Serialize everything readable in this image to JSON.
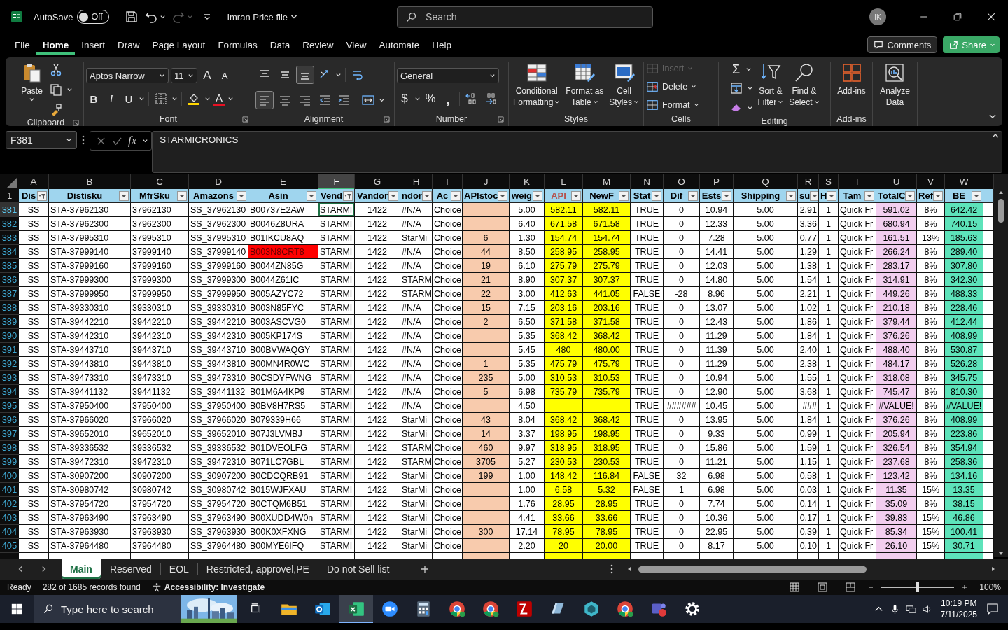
{
  "title_bar": {
    "autosave_label": "AutoSave",
    "autosave": {
      "on": false,
      "label": "Off"
    },
    "redo": {
      "disabled": true
    },
    "file_name": "Imran Price file",
    "search_placeholder": "Search",
    "avatar": "IK"
  },
  "menu_tabs": [
    {
      "label": "File",
      "selected": false
    },
    {
      "label": "Home",
      "selected": true
    },
    {
      "label": "Insert",
      "selected": false
    },
    {
      "label": "Draw",
      "selected": false
    },
    {
      "label": "Page Layout",
      "selected": false
    },
    {
      "label": "Formulas",
      "selected": false
    },
    {
      "label": "Data",
      "selected": false
    },
    {
      "label": "Review",
      "selected": false
    },
    {
      "label": "View",
      "selected": false
    },
    {
      "label": "Automate",
      "selected": false
    },
    {
      "label": "Help",
      "selected": false
    }
  ],
  "comments_button": "Comments",
  "share_button": "Share",
  "ribbon": {
    "groups": [
      {
        "kind": "clipboard",
        "label": "Clipboard",
        "paste": "Paste"
      },
      {
        "kind": "font",
        "label": "Font",
        "font_name": "Aptos Narrow",
        "font_size": "11",
        "grow": "A",
        "shrink": "A",
        "styles": [
          "B",
          "I",
          "U"
        ],
        "font_color": "A"
      },
      {
        "kind": "alignment",
        "label": "Alignment",
        "vertical": [
          {
            "on": false
          },
          {
            "on": false
          },
          {
            "on": true
          }
        ],
        "horizontal": [
          {
            "on": true
          },
          {
            "on": false
          },
          {
            "on": false
          }
        ]
      },
      {
        "kind": "number",
        "label": "Number",
        "format": "General",
        "currency": "$",
        "percent": "%",
        "comma": ","
      },
      {
        "kind": "styles",
        "label": "Styles",
        "buttons": [
          {
            "line1": "Conditional",
            "line2": "Formatting"
          },
          {
            "line1": "Format as",
            "line2": "Table"
          },
          {
            "line1": "Cell",
            "line2": "Styles"
          }
        ]
      },
      {
        "kind": "cells",
        "label": "Cells",
        "buttons": [
          {
            "label": "Insert",
            "disabled": true
          },
          {
            "label": "Delete",
            "disabled": false
          },
          {
            "label": "Format",
            "disabled": false
          }
        ]
      },
      {
        "kind": "editing",
        "label": "Editing",
        "sum": "Σ",
        "buttons": [
          {
            "line1": "Sort &",
            "line2": "Filter"
          },
          {
            "line1": "Find &",
            "line2": "Select"
          }
        ]
      },
      {
        "kind": "addins",
        "label": "Add-ins",
        "button": "Add-ins"
      },
      {
        "kind": "analyze",
        "line1": "Analyze",
        "line2": "Data"
      }
    ]
  },
  "formula_bar": {
    "name_box": "F381",
    "fx": "fx",
    "content": "STARMICRONICS"
  },
  "columns": [
    {
      "letter": "A",
      "header": "Dis",
      "filtered": true,
      "selected": false,
      "header_warning": false
    },
    {
      "letter": "B",
      "header": "Distisku",
      "filtered": false,
      "selected": false,
      "header_warning": false
    },
    {
      "letter": "C",
      "header": "MfrSku",
      "filtered": false,
      "selected": false,
      "header_warning": false
    },
    {
      "letter": "D",
      "header": "Amazons",
      "filtered": false,
      "selected": false,
      "header_warning": false
    },
    {
      "letter": "E",
      "header": "Asin",
      "filtered": false,
      "selected": false,
      "header_warning": false
    },
    {
      "letter": "F",
      "header": "Vend",
      "filtered": true,
      "selected": true,
      "header_warning": false
    },
    {
      "letter": "G",
      "header": "Vandor",
      "filtered": false,
      "selected": false,
      "header_warning": false
    },
    {
      "letter": "H",
      "header": "ndor",
      "filtered": false,
      "selected": false,
      "header_warning": false
    },
    {
      "letter": "I",
      "header": "Ac",
      "filtered": false,
      "selected": false,
      "header_warning": false
    },
    {
      "letter": "J",
      "header": "APIstoc",
      "filtered": false,
      "selected": false,
      "header_warning": false,
      "color": "#f8cbad"
    },
    {
      "letter": "K",
      "header": "weig",
      "filtered": false,
      "selected": false,
      "header_warning": false
    },
    {
      "letter": "L",
      "header": "API",
      "filtered": false,
      "selected": false,
      "header_warning": true,
      "color": "#ffff00"
    },
    {
      "letter": "M",
      "header": "NewF",
      "filtered": false,
      "selected": false,
      "header_warning": false,
      "color": "#ffff00"
    },
    {
      "letter": "N",
      "header": "Stat",
      "filtered": false,
      "selected": false,
      "header_warning": false
    },
    {
      "letter": "O",
      "header": "Dif",
      "filtered": false,
      "selected": false,
      "header_warning": false
    },
    {
      "letter": "P",
      "header": "Ests",
      "filtered": false,
      "selected": false,
      "header_warning": false
    },
    {
      "letter": "Q",
      "header": "Shipping",
      "filtered": false,
      "selected": false,
      "header_warning": false
    },
    {
      "letter": "R",
      "header": "su",
      "filtered": false,
      "selected": false,
      "header_warning": false
    },
    {
      "letter": "S",
      "header": "H",
      "filtered": false,
      "selected": false,
      "header_warning": false
    },
    {
      "letter": "T",
      "header": "Tam",
      "filtered": false,
      "selected": false,
      "header_warning": false
    },
    {
      "letter": "U",
      "header": "TotalC",
      "filtered": false,
      "selected": false,
      "header_warning": false,
      "color": "#f2ceef"
    },
    {
      "letter": "V",
      "header": "Ref",
      "filtered": false,
      "selected": false,
      "header_warning": false
    },
    {
      "letter": "W",
      "header": "BE",
      "filtered": false,
      "selected": false,
      "header_warning": false,
      "color": "#5de3ba"
    }
  ],
  "header_row": "1",
  "rows": [
    {
      "n": "381",
      "selected": true,
      "flagged": false,
      "cells": [
        "SS",
        "STA-37962130",
        "37962130",
        "SS_37962130",
        "B00737E2AW",
        "STARMI",
        "1422",
        "#N/A",
        "Choice",
        null,
        "5.00",
        "582.11",
        "582.11",
        "TRUE",
        "0",
        "10.94",
        "5.00",
        "2.91",
        "1",
        "Quick Fr",
        "591.02",
        "8%",
        "642.42"
      ]
    },
    {
      "n": "382",
      "selected": false,
      "flagged": false,
      "cells": [
        "SS",
        "STA-37962300",
        "37962300",
        "SS_37962300",
        "B0046Z8URA",
        "STARMI",
        "1422",
        "#N/A",
        "Choice",
        null,
        "6.40",
        "671.58",
        "671.58",
        "TRUE",
        "0",
        "12.33",
        "5.00",
        "3.36",
        "1",
        "Quick Fr",
        "680.94",
        "8%",
        "740.15"
      ]
    },
    {
      "n": "383",
      "selected": false,
      "flagged": false,
      "cells": [
        "SS",
        "STA-37995310",
        "37995310",
        "SS_37995310",
        "B01IKCU8AQ",
        "STARMI",
        "1422",
        "StarMi",
        "Choice",
        "6",
        "1.30",
        "154.74",
        "154.74",
        "TRUE",
        "0",
        "7.28",
        "5.00",
        "0.77",
        "1",
        "Quick Fr",
        "161.51",
        "13%",
        "185.63"
      ]
    },
    {
      "n": "384",
      "selected": false,
      "flagged": true,
      "cells": [
        "SS",
        "STA-37999140",
        "37999140",
        "SS_37999140",
        "B003N8CRT8",
        "STARMI",
        "1422",
        "#N/A",
        "Choice",
        "44",
        "8.50",
        "258.95",
        "258.95",
        "TRUE",
        "0",
        "14.41",
        "5.00",
        "1.29",
        "1",
        "Quick Fr",
        "266.24",
        "8%",
        "289.40"
      ]
    },
    {
      "n": "385",
      "selected": false,
      "flagged": false,
      "cells": [
        "SS",
        "STA-37999160",
        "37999160",
        "SS_37999160",
        "B0044ZN85G",
        "STARMI",
        "1422",
        "#N/A",
        "Choice",
        "19",
        "6.10",
        "275.79",
        "275.79",
        "TRUE",
        "0",
        "12.03",
        "5.00",
        "1.38",
        "1",
        "Quick Fr",
        "283.17",
        "8%",
        "307.80"
      ]
    },
    {
      "n": "386",
      "selected": false,
      "flagged": false,
      "cells": [
        "SS",
        "STA-37999300",
        "37999300",
        "SS_37999300",
        "B0044Z61IC",
        "STARMI",
        "1422",
        "STARM",
        "Choice",
        "21",
        "8.90",
        "307.37",
        "307.37",
        "TRUE",
        "0",
        "14.80",
        "5.00",
        "1.54",
        "1",
        "Quick Fr",
        "314.91",
        "8%",
        "342.30"
      ]
    },
    {
      "n": "387",
      "selected": false,
      "flagged": false,
      "cells": [
        "SS",
        "STA-37999950",
        "37999950",
        "SS_37999950",
        "B005AZYC72",
        "STARMI",
        "1422",
        "STARM",
        "Choice",
        "22",
        "3.00",
        "412.63",
        "441.05",
        "FALSE",
        "-28",
        "8.96",
        "5.00",
        "2.21",
        "1",
        "Quick Fr",
        "449.26",
        "8%",
        "488.33"
      ]
    },
    {
      "n": "388",
      "selected": false,
      "flagged": false,
      "cells": [
        "SS",
        "STA-39330310",
        "39330310",
        "SS_39330310",
        "B003N85FYC",
        "STARMI",
        "1422",
        "#N/A",
        "Choice",
        "15",
        "7.15",
        "203.16",
        "203.16",
        "TRUE",
        "0",
        "13.07",
        "5.00",
        "1.02",
        "1",
        "Quick Fr",
        "210.18",
        "8%",
        "228.46"
      ]
    },
    {
      "n": "389",
      "selected": false,
      "flagged": false,
      "cells": [
        "SS",
        "STA-39442210",
        "39442210",
        "SS_39442210",
        "B003ASCVG0",
        "STARMI",
        "1422",
        "#N/A",
        "Choice",
        "2",
        "6.50",
        "371.58",
        "371.58",
        "TRUE",
        "0",
        "12.43",
        "5.00",
        "1.86",
        "1",
        "Quick Fr",
        "379.44",
        "8%",
        "412.44"
      ]
    },
    {
      "n": "390",
      "selected": false,
      "flagged": false,
      "cells": [
        "SS",
        "STA-39442310",
        "39442310",
        "SS_39442310",
        "B005KP174S",
        "STARMI",
        "1422",
        "#N/A",
        "Choice",
        null,
        "5.35",
        "368.42",
        "368.42",
        "TRUE",
        "0",
        "11.29",
        "5.00",
        "1.84",
        "1",
        "Quick Fr",
        "376.26",
        "8%",
        "408.99"
      ]
    },
    {
      "n": "391",
      "selected": false,
      "flagged": false,
      "cells": [
        "SS",
        "STA-39443710",
        "39443710",
        "SS_39443710",
        "B00BVWAQGY",
        "STARMI",
        "1422",
        "#N/A",
        "Choice",
        null,
        "5.45",
        "480",
        "480.00",
        "TRUE",
        "0",
        "11.39",
        "5.00",
        "2.40",
        "1",
        "Quick Fr",
        "488.40",
        "8%",
        "530.87"
      ]
    },
    {
      "n": "392",
      "selected": false,
      "flagged": false,
      "cells": [
        "SS",
        "STA-39443810",
        "39443810",
        "SS_39443810",
        "B00MN4R0WC",
        "STARMI",
        "1422",
        "#N/A",
        "Choice",
        "1",
        "5.35",
        "475.79",
        "475.79",
        "TRUE",
        "0",
        "11.29",
        "5.00",
        "2.38",
        "1",
        "Quick Fr",
        "484.17",
        "8%",
        "526.28"
      ]
    },
    {
      "n": "393",
      "selected": false,
      "flagged": false,
      "cells": [
        "SS",
        "STA-39473310",
        "39473310",
        "SS_39473310",
        "B0CSDYFWNG",
        "STARMI",
        "1422",
        "#N/A",
        "Choice",
        "235",
        "5.00",
        "310.53",
        "310.53",
        "TRUE",
        "0",
        "10.94",
        "5.00",
        "1.55",
        "1",
        "Quick Fr",
        "318.08",
        "8%",
        "345.75"
      ]
    },
    {
      "n": "394",
      "selected": false,
      "flagged": false,
      "cells": [
        "SS",
        "STA-39441132",
        "39441132",
        "SS_39441132",
        "B01M6A4KP9",
        "STARMI",
        "1422",
        "#N/A",
        "Choice",
        "5",
        "6.98",
        "735.79",
        "735.79",
        "TRUE",
        "0",
        "12.90",
        "5.00",
        "3.68",
        "1",
        "Quick Fr",
        "745.47",
        "8%",
        "810.30"
      ]
    },
    {
      "n": "395",
      "selected": false,
      "flagged": false,
      "cells": [
        "SS",
        "STA-37950400",
        "37950400",
        "SS_37950400",
        "B0BV8H7RS5",
        "STARMI",
        "1422",
        "#N/A",
        "Choice",
        null,
        "4.50",
        null,
        null,
        "TRUE",
        "######",
        "10.45",
        "5.00",
        "###",
        "1",
        "Quick Fr",
        "#VALUE!",
        "8%",
        "#VALUE!"
      ]
    },
    {
      "n": "396",
      "selected": false,
      "flagged": false,
      "cells": [
        "SS",
        "STA-37966020",
        "37966020",
        "SS_37966020",
        "B079339H66",
        "STARMI",
        "1422",
        "StarMi",
        "Choice",
        "43",
        "8.04",
        "368.42",
        "368.42",
        "TRUE",
        "0",
        "13.95",
        "5.00",
        "1.84",
        "1",
        "Quick Fr",
        "376.26",
        "8%",
        "408.99"
      ]
    },
    {
      "n": "397",
      "selected": false,
      "flagged": false,
      "cells": [
        "SS",
        "STA-39652010",
        "39652010",
        "SS_39652010",
        "B07J3LVMBJ",
        "STARMI",
        "1422",
        "StarMi",
        "Choice",
        "14",
        "3.37",
        "198.95",
        "198.95",
        "TRUE",
        "0",
        "9.33",
        "5.00",
        "0.99",
        "1",
        "Quick Fr",
        "205.94",
        "8%",
        "223.86"
      ]
    },
    {
      "n": "398",
      "selected": false,
      "flagged": false,
      "cells": [
        "SS",
        "STA-39336532",
        "39336532",
        "SS_39336532",
        "B01DVEOLFG",
        "STARMI",
        "1422",
        "STARM",
        "Choice",
        "460",
        "9.97",
        "318.95",
        "318.95",
        "TRUE",
        "0",
        "15.86",
        "5.00",
        "1.59",
        "1",
        "Quick Fr",
        "326.54",
        "8%",
        "354.94"
      ]
    },
    {
      "n": "399",
      "selected": false,
      "flagged": false,
      "cells": [
        "SS",
        "STA-39472310",
        "39472310",
        "SS_39472310",
        "B071LC7GBL",
        "STARMI",
        "1422",
        "STARM",
        "Choice",
        "3705",
        "5.27",
        "230.53",
        "230.53",
        "TRUE",
        "0",
        "11.21",
        "5.00",
        "1.15",
        "1",
        "Quick Fr",
        "237.68",
        "8%",
        "258.36"
      ]
    },
    {
      "n": "400",
      "selected": false,
      "flagged": false,
      "cells": [
        "SS",
        "STA-30907200",
        "30907200",
        "SS_30907200",
        "B0CDCQRB91",
        "STARMI",
        "1422",
        "StarMi",
        "Choice",
        "199",
        "1.00",
        "148.42",
        "116.84",
        "FALSE",
        "32",
        "6.98",
        "5.00",
        "0.58",
        "1",
        "Quick Fr",
        "123.42",
        "8%",
        "134.16"
      ]
    },
    {
      "n": "401",
      "selected": false,
      "flagged": false,
      "cells": [
        "SS",
        "STA-30980742",
        "30980742",
        "SS_30980742",
        "B015WJFXAU",
        "STARMI",
        "1422",
        "StarMi",
        "Choice",
        null,
        "1.00",
        "6.58",
        "5.32",
        "FALSE",
        "1",
        "6.98",
        "5.00",
        "0.03",
        "1",
        "Quick Fr",
        "11.35",
        "15%",
        "13.35"
      ]
    },
    {
      "n": "402",
      "selected": false,
      "flagged": false,
      "cells": [
        "SS",
        "STA-37954720",
        "37954720",
        "SS_37954720",
        "B0CTQM6B51",
        "STARMI",
        "1422",
        "StarMi",
        "Choice",
        null,
        "1.76",
        "28.95",
        "28.95",
        "TRUE",
        "0",
        "7.74",
        "5.00",
        "0.14",
        "1",
        "Quick Fr",
        "35.09",
        "8%",
        "38.15"
      ]
    },
    {
      "n": "403",
      "selected": false,
      "flagged": false,
      "cells": [
        "SS",
        "STA-37963490",
        "37963490",
        "SS_37963490",
        "B00XUDD4W0n",
        "STARMI",
        "1422",
        "StarMi",
        "Choice",
        null,
        "4.41",
        "33.66",
        "33.66",
        "TRUE",
        "0",
        "10.36",
        "5.00",
        "0.17",
        "1",
        "Quick Fr",
        "39.83",
        "15%",
        "46.86"
      ]
    },
    {
      "n": "404",
      "selected": false,
      "flagged": false,
      "cells": [
        "SS",
        "STA-37963930",
        "37963930",
        "SS_37963930",
        "B00K0XFXNG",
        "STARMI",
        "1422",
        "StarMi",
        "Choice",
        "300",
        "17.14",
        "78.95",
        "78.95",
        "TRUE",
        "0",
        "22.95",
        "5.00",
        "0.39",
        "1",
        "Quick Fr",
        "85.34",
        "15%",
        "100.41"
      ]
    },
    {
      "n": "405",
      "selected": false,
      "flagged": false,
      "cells": [
        "SS",
        "STA-37964480",
        "37964480",
        "SS_37964480",
        "B00MYE6IFQ",
        "STARMI",
        "1422",
        "StarMi",
        "Choice",
        null,
        "2.20",
        "20",
        "20.00",
        "TRUE",
        "0",
        "8.17",
        "5.00",
        "0.10",
        "1",
        "Quick Fr",
        "26.10",
        "15%",
        "30.71"
      ]
    }
  ],
  "sheet_tabs": [
    {
      "label": "Main",
      "selected": true
    },
    {
      "label": "Reserved",
      "selected": false
    },
    {
      "label": "EOL",
      "selected": false
    },
    {
      "label": "Restricted, approvel,PE",
      "selected": false
    },
    {
      "label": "Do not Sell list",
      "selected": false
    }
  ],
  "status_bar": {
    "mode": "Ready",
    "records": "282 of 1685 records found",
    "accessibility": "Accessibility: Investigate",
    "zoom": {
      "level": 0.5
    },
    "zoom_label": "100%"
  },
  "taskbar": {
    "search_placeholder": "Type here to search",
    "apps": [
      {
        "kind": "folder",
        "selected": false
      },
      {
        "kind": "mail",
        "selected": false
      },
      {
        "kind": "sheet",
        "selected": true
      },
      {
        "kind": "video",
        "selected": false
      },
      {
        "kind": "calculator",
        "selected": false
      },
      {
        "kind": "browser",
        "selected": false
      },
      {
        "kind": "browser",
        "selected": false
      },
      {
        "kind": "ftp",
        "selected": false
      },
      {
        "kind": "notes",
        "selected": false
      },
      {
        "kind": "cube",
        "selected": false
      },
      {
        "kind": "browser",
        "selected": false
      },
      {
        "kind": "team",
        "selected": false
      },
      {
        "kind": "gear",
        "selected": false
      }
    ],
    "time": "10:19 PM",
    "date": "7/11/2025"
  }
}
